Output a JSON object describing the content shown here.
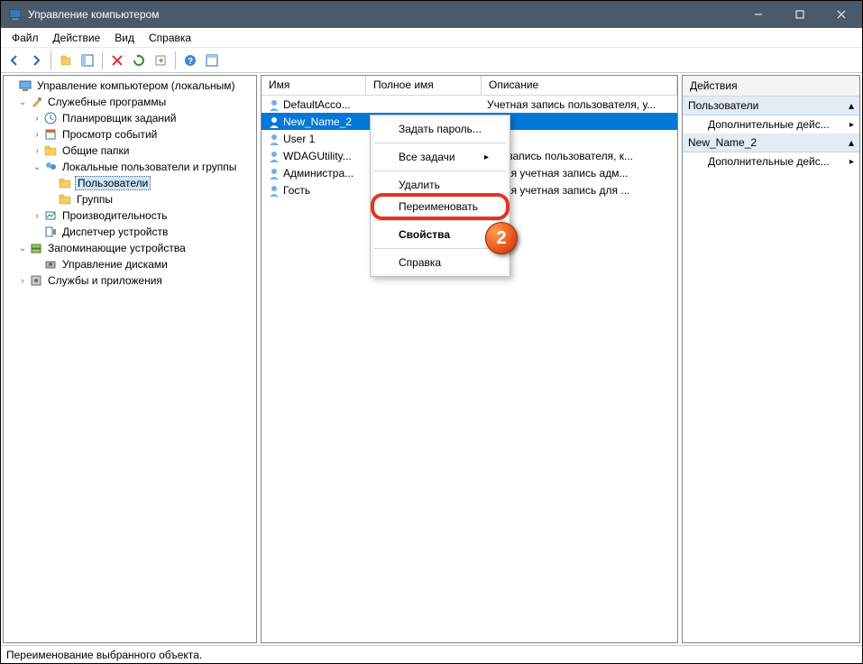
{
  "window": {
    "title": "Управление компьютером"
  },
  "menubar": {
    "file": "Файл",
    "action": "Действие",
    "view": "Вид",
    "help": "Справка"
  },
  "tree": {
    "root": "Управление компьютером (локальным)",
    "services_grp": "Служебные программы",
    "task_sched": "Планировщик заданий",
    "event_viewer": "Просмотр событий",
    "shared_folders": "Общие папки",
    "local_users_groups": "Локальные пользователи и группы",
    "users": "Пользователи",
    "groups": "Группы",
    "performance": "Производительность",
    "device_mgr": "Диспетчер устройств",
    "storage": "Запоминающие устройства",
    "disk_mgmt": "Управление дисками",
    "services_apps": "Службы и приложения"
  },
  "list": {
    "header": {
      "name": "Имя",
      "fullname": "Полное имя",
      "description": "Описание"
    },
    "rows": [
      {
        "name": "DefaultAcco...",
        "full": "",
        "desc": "Учетная запись пользователя, у..."
      },
      {
        "name": "New_Name_2",
        "full": "",
        "desc": ""
      },
      {
        "name": "User 1",
        "full": "",
        "desc": ""
      },
      {
        "name": "WDAGUtility...",
        "full": "",
        "desc": "ная запись пользователя, к..."
      },
      {
        "name": "Администра...",
        "full": "",
        "desc": "енная учетная запись адм..."
      },
      {
        "name": "Гость",
        "full": "",
        "desc": "енная учетная запись для ..."
      }
    ]
  },
  "context_menu": {
    "set_password": "Задать пароль...",
    "all_tasks": "Все задачи",
    "delete": "Удалить",
    "rename": "Переименовать",
    "properties": "Свойства",
    "help": "Справка"
  },
  "actions": {
    "header": "Действия",
    "section1": "Пользователи",
    "more1": "Дополнительные дейс...",
    "section2": "New_Name_2",
    "more2": "Дополнительные дейс..."
  },
  "statusbar": {
    "text": "Переименование выбранного объекта."
  },
  "callout": {
    "num": "2"
  },
  "arrows": {
    "up": "▴",
    "right": "▸"
  }
}
